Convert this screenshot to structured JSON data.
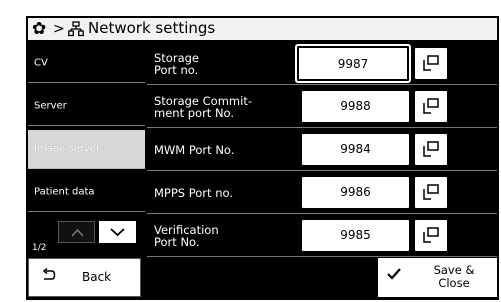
{
  "header": {
    "separator": ">",
    "title": "Network settings"
  },
  "sidebar": {
    "items": [
      {
        "label": "CV"
      },
      {
        "label": "Server"
      },
      {
        "label": "Image server",
        "active": true
      },
      {
        "label": "Patient data"
      }
    ],
    "page": "1/2"
  },
  "rows": [
    {
      "label": "Storage\nPort no.",
      "value": "9987"
    },
    {
      "label": "Storage Commit-\nment port No.",
      "value": "9988"
    },
    {
      "label": "MWM Port No.",
      "value": "9984"
    },
    {
      "label": "MPPS Port no.",
      "value": "9986"
    },
    {
      "label": "Verification\nPort No.",
      "value": "9985"
    }
  ],
  "footer": {
    "back_label": "Back",
    "save_label": "Save &\nClose"
  },
  "colors": {
    "background": "#000000",
    "active_tab": "#d8d8d8",
    "field": "#ffffff"
  }
}
